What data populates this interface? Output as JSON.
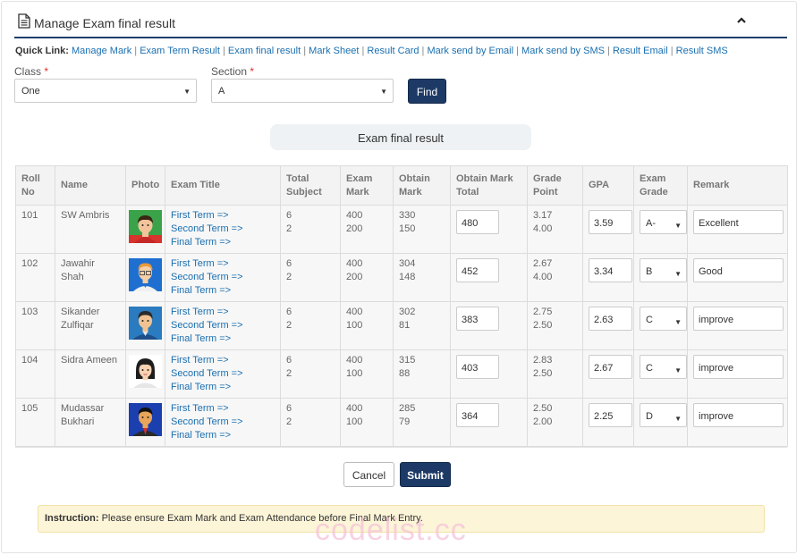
{
  "header": {
    "title": "Manage Exam final result"
  },
  "quick_links": {
    "label": "Quick Link:",
    "items": [
      "Manage Mark",
      "Exam Term Result",
      "Exam final result",
      "Mark Sheet",
      "Result Card",
      "Mark send by Email",
      "Mark send by SMS",
      "Result Email",
      "Result SMS"
    ]
  },
  "filters": {
    "class_label": "Class",
    "class_value": "One",
    "section_label": "Section",
    "section_value": "A",
    "required_mark": "*",
    "find_label": "Find"
  },
  "section_title": "Exam final result",
  "table": {
    "headers": [
      "Roll No",
      "Name",
      "Photo",
      "Exam Title",
      "Total Subject",
      "Exam Mark",
      "Obtain Mark",
      "Obtain Mark Total",
      "Grade Point",
      "GPA",
      "Exam Grade",
      "Remark"
    ],
    "exam_titles": [
      "First Term =>",
      "Second Term =>",
      "Final Term =>"
    ],
    "rows": [
      {
        "roll": "101",
        "name": "SW Ambris",
        "subjects": [
          "6",
          "2"
        ],
        "exam_mark": [
          "400",
          "200"
        ],
        "obtain_mark": [
          "330",
          "150"
        ],
        "total": "480",
        "grade_point": [
          "3.17",
          "4.00"
        ],
        "gpa": "3.59",
        "grade": "A-",
        "remark": "Excellent"
      },
      {
        "roll": "102",
        "name": "Jawahir Shah",
        "subjects": [
          "6",
          "2"
        ],
        "exam_mark": [
          "400",
          "200"
        ],
        "obtain_mark": [
          "304",
          "148"
        ],
        "total": "452",
        "grade_point": [
          "2.67",
          "4.00"
        ],
        "gpa": "3.34",
        "grade": "B",
        "remark": "Good"
      },
      {
        "roll": "103",
        "name": "Sikander Zulfiqar",
        "subjects": [
          "6",
          "2"
        ],
        "exam_mark": [
          "400",
          "100"
        ],
        "obtain_mark": [
          "302",
          "81"
        ],
        "total": "383",
        "grade_point": [
          "2.75",
          "2.50"
        ],
        "gpa": "2.63",
        "grade": "C",
        "remark": "improve"
      },
      {
        "roll": "104",
        "name": "Sidra Ameen",
        "subjects": [
          "6",
          "2"
        ],
        "exam_mark": [
          "400",
          "100"
        ],
        "obtain_mark": [
          "315",
          "88"
        ],
        "total": "403",
        "grade_point": [
          "2.83",
          "2.50"
        ],
        "gpa": "2.67",
        "grade": "C",
        "remark": "improve"
      },
      {
        "roll": "105",
        "name": "Mudassar Bukhari",
        "subjects": [
          "6",
          "2"
        ],
        "exam_mark": [
          "400",
          "100"
        ],
        "obtain_mark": [
          "285",
          "79"
        ],
        "total": "364",
        "grade_point": [
          "2.50",
          "2.00"
        ],
        "gpa": "2.25",
        "grade": "D",
        "remark": "improve"
      }
    ]
  },
  "actions": {
    "cancel_label": "Cancel",
    "submit_label": "Submit"
  },
  "instruction": {
    "label": "Instruction:",
    "text": "Please ensure Exam Mark and Exam Attendance before Final Mark Entry."
  },
  "watermark": "codelist.cc",
  "colors": {
    "primary": "#1d3a66",
    "link": "#1a6fb0",
    "instruction_bg": "#fcf5d8",
    "required": "#e03131"
  },
  "icons": {
    "title": "document-icon",
    "collapse": "chevron-up-icon",
    "dropdown": "caret-down-icon"
  }
}
